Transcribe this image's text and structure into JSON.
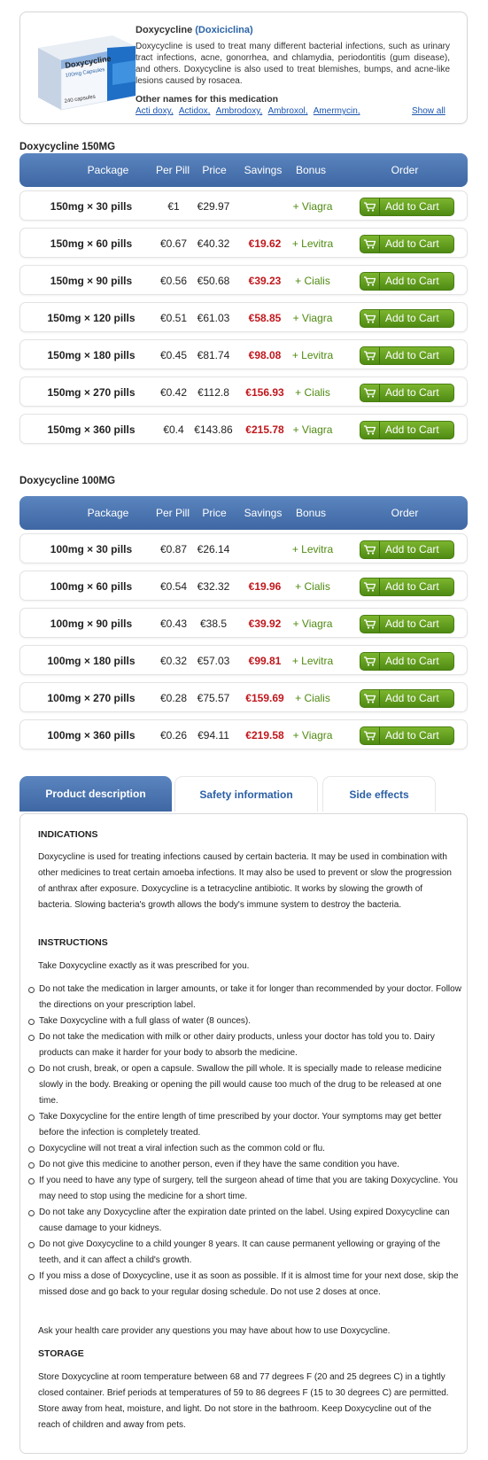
{
  "product": {
    "name": "Doxycycline",
    "alt_name": "(Doxiciclina)",
    "description": "Doxycycline is used to treat many different bacterial infections, such as urinary tract infections, acne, gonorrhea, and chlamydia, periodontitis (gum disease), and others. Doxycycline is also used to treat blemishes, bumps, and acne-like lesions caused by rosacea.",
    "other_names_title": "Other names for this medication",
    "other_names": [
      "Acti doxy,",
      "Actidox,",
      "Ambrodoxy,",
      "Ambroxol,",
      "Amermycin,"
    ],
    "show_all": "Show all",
    "box": {
      "brand": "Doxycycline",
      "strength": "100mg Capsules",
      "count": "240 capsules"
    }
  },
  "table_headers": [
    "Package",
    "Per Pill",
    "Price",
    "Savings",
    "Bonus",
    "Order"
  ],
  "add_to_cart": "Add to Cart",
  "sections": [
    {
      "title": "Doxycycline 150MG",
      "rows": [
        {
          "package": "150mg × 30 pills",
          "per_pill": "€1",
          "price": "€29.97",
          "savings": "",
          "bonus": "+ Viagra"
        },
        {
          "package": "150mg × 60 pills",
          "per_pill": "€0.67",
          "price": "€40.32",
          "savings": "€19.62",
          "bonus": "+ Levitra"
        },
        {
          "package": "150mg × 90 pills",
          "per_pill": "€0.56",
          "price": "€50.68",
          "savings": "€39.23",
          "bonus": "+ Cialis"
        },
        {
          "package": "150mg × 120 pills",
          "per_pill": "€0.51",
          "price": "€61.03",
          "savings": "€58.85",
          "bonus": "+ Viagra"
        },
        {
          "package": "150mg × 180 pills",
          "per_pill": "€0.45",
          "price": "€81.74",
          "savings": "€98.08",
          "bonus": "+ Levitra"
        },
        {
          "package": "150mg × 270 pills",
          "per_pill": "€0.42",
          "price": "€112.8",
          "savings": "€156.93",
          "bonus": "+ Cialis"
        },
        {
          "package": "150mg × 360 pills",
          "per_pill": "€0.4",
          "price": "€143.86",
          "savings": "€215.78",
          "bonus": "+ Viagra"
        }
      ]
    },
    {
      "title": "Doxycycline 100MG",
      "rows": [
        {
          "package": "100mg × 30 pills",
          "per_pill": "€0.87",
          "price": "€26.14",
          "savings": "",
          "bonus": "+ Levitra"
        },
        {
          "package": "100mg × 60 pills",
          "per_pill": "€0.54",
          "price": "€32.32",
          "savings": "€19.96",
          "bonus": "+ Cialis"
        },
        {
          "package": "100mg × 90 pills",
          "per_pill": "€0.43",
          "price": "€38.5",
          "savings": "€39.92",
          "bonus": "+ Viagra"
        },
        {
          "package": "100mg × 180 pills",
          "per_pill": "€0.32",
          "price": "€57.03",
          "savings": "€99.81",
          "bonus": "+ Levitra"
        },
        {
          "package": "100mg × 270 pills",
          "per_pill": "€0.28",
          "price": "€75.57",
          "savings": "€159.69",
          "bonus": "+ Cialis"
        },
        {
          "package": "100mg × 360 pills",
          "per_pill": "€0.26",
          "price": "€94.11",
          "savings": "€219.58",
          "bonus": "+ Viagra"
        }
      ]
    }
  ],
  "tabs": [
    "Product description",
    "Safety information",
    "Side effects"
  ],
  "content": {
    "indications_title": "INDICATIONS",
    "indications_text": "Doxycycline is used for treating infections caused by certain bacteria. It may be used in combination with other medicines to treat certain amoeba infections. It may also be used to prevent or slow the progression of anthrax after exposure. Doxycycline is a tetracycline antibiotic. It works by slowing the growth of bacteria. Slowing bacteria's growth allows the body's immune system to destroy the bacteria.",
    "instructions_title": "INSTRUCTIONS",
    "instructions_intro": "Take Doxycycline exactly as it was prescribed for you.",
    "instructions_items": [
      "Do not take the medication in larger amounts, or take it for longer than recommended by your doctor. Follow the directions on your prescription label.",
      "Take Doxycycline with a full glass of water (8 ounces).",
      "Do not take the medication with milk or other dairy products, unless your doctor has told you to. Dairy products can make it harder for your body to absorb the medicine.",
      "Do not crush, break, or open a capsule. Swallow the pill whole. It is specially made to release medicine slowly in the body. Breaking or opening the pill would cause too much of the drug to be released at one time.",
      "Take Doxycycline for the entire length of time prescribed by your doctor. Your symptoms may get better before the infection is completely treated.",
      " Doxycycline will not treat a viral infection such as the common cold or flu.",
      " Do not give this medicine to another person, even if they have the same condition you have.",
      "If you need to have any type of surgery, tell the surgeon ahead of time that you are taking Doxycycline. You may need to stop using the medicine for a short time.",
      "Do not take any Doxycycline after the expiration date printed on the label. Using expired Doxycycline can cause damage to your kidneys.",
      "Do not give Doxycycline to a child younger 8 years. It can cause permanent yellowing or graying of the teeth, and it can affect a child's growth.",
      "If you miss a dose of Doxycycline, use it as soon as possible. If it is almost time for your next dose, skip the missed dose and go back to your regular dosing schedule. Do not use 2 doses at once."
    ],
    "instructions_outro": "Ask your health care provider any questions you may have about how to use Doxycycline.",
    "storage_title": "STORAGE",
    "storage_text": "Store Doxycycline at room temperature between 68 and 77 degrees F (20 and 25 degrees C) in a tightly closed container. Brief periods at temperatures of 59 to 86 degrees F (15 to 30 degrees C) are permitted. Store away from heat, moisture, and light. Do not store in the bathroom. Keep Doxycycline out of the reach of children and away from pets."
  }
}
